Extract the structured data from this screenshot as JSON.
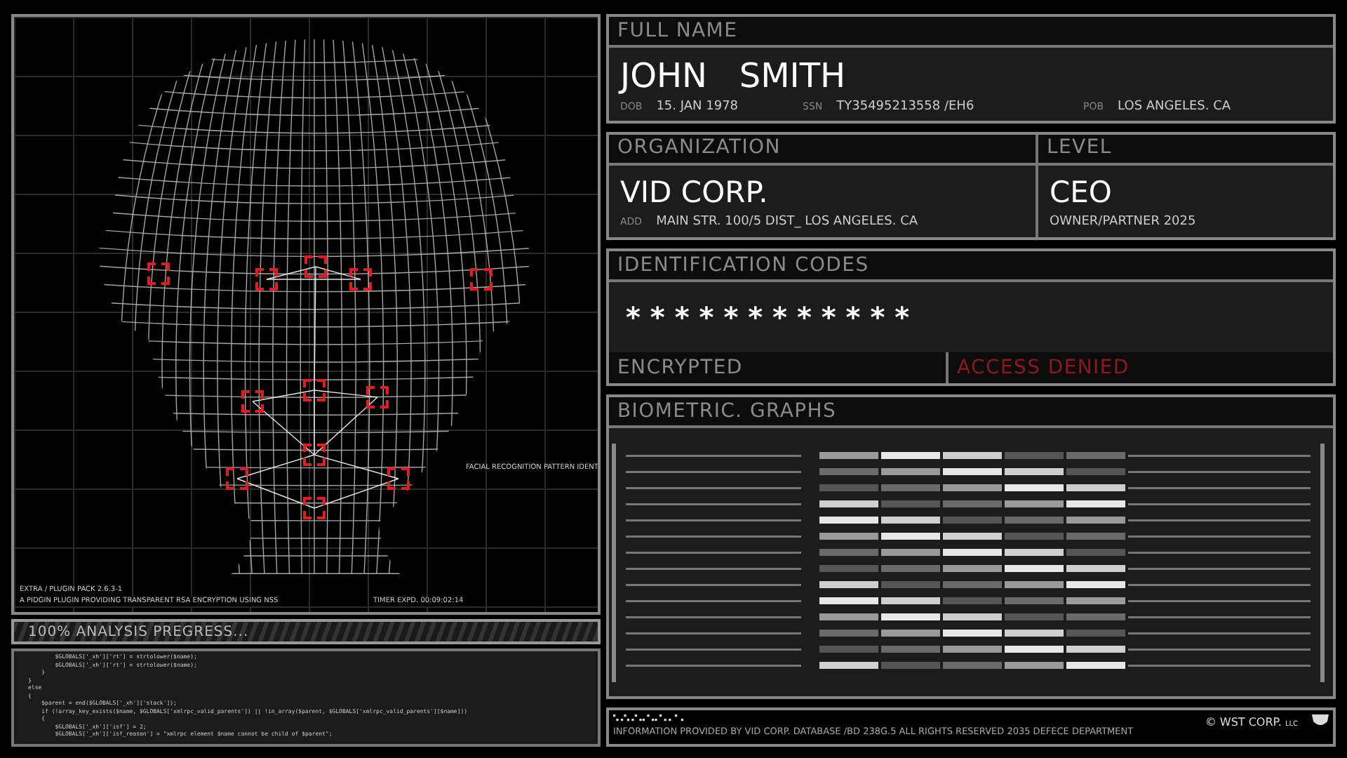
{
  "scan": {
    "pattern_label": "FACIAL RECOGNITION PATTERN IDENT",
    "plugin_lines": [
      "EXTRA / PLUGIN PACK 2.6.3-1",
      "A PIDGIN PLUGIN PROVIDING TRANSPARENT RSA ENCRYPTION USING NSS"
    ],
    "timer": "TIMER EXPD. 00:09:02:14"
  },
  "progress": {
    "label": "100% ANALYSIS PREGRESS...",
    "level": 1
  },
  "code_lines": [
    "        $GLOBALS['_xh']['rt'] = strtolower($name);",
    "        $GLOBALS['_xh']['rt'] = strtolower($name);",
    "    }",
    "}",
    "else",
    "{",
    "    $parent = end($GLOBALS['_xh']['stack']);",
    "    if (!array_key_exists($name, $GLOBALS['xmlrpc_valid_parents']) || !in_array($parent, $GLOBALS['xmlrpc_valid_parents'][$name]))",
    "    {",
    "        $GLOBALS['_xh']['isf'] = 2;",
    "        $GLOBALS['_xh']['isf_reason'] = \"xmlrpc element $name cannot be child of $parent\";"
  ],
  "full_name": {
    "title": "FULL NAME",
    "name": "JOHN   SMITH",
    "fields": [
      {
        "label": "DOB",
        "value": "15. JAN 1978"
      },
      {
        "label": "SSN",
        "value": "TY35495213558 /EH6"
      },
      {
        "label": "POB",
        "value": "LOS ANGELES. CA"
      }
    ]
  },
  "organization": {
    "title": "ORGANIZATION",
    "name": "VID CORP.",
    "address_label": "ADD",
    "address": "MAIN STR. 100/5 DIST_ LOS ANGELES. CA"
  },
  "level": {
    "title": "LEVEL",
    "value": "CEO",
    "detail": "OWNER/PARTNER 2025"
  },
  "identification": {
    "title": "IDENTIFICATION CODES",
    "code": "* * * * * * * * * * * *",
    "status": "ENCRYPTED",
    "access": "ACCESS DENIED"
  },
  "biometric": {
    "title": "BIOMETRIC. GRAPHS"
  },
  "footer": {
    "info": "INFORMATION PROVIDED BY VID CORP. DATABASE /BD 238G.5 ALL RIGHTS RESERVED 2035 DEFECE DEPARTMENT",
    "copyright": "© WST CORP.",
    "suffix": "LLC"
  }
}
